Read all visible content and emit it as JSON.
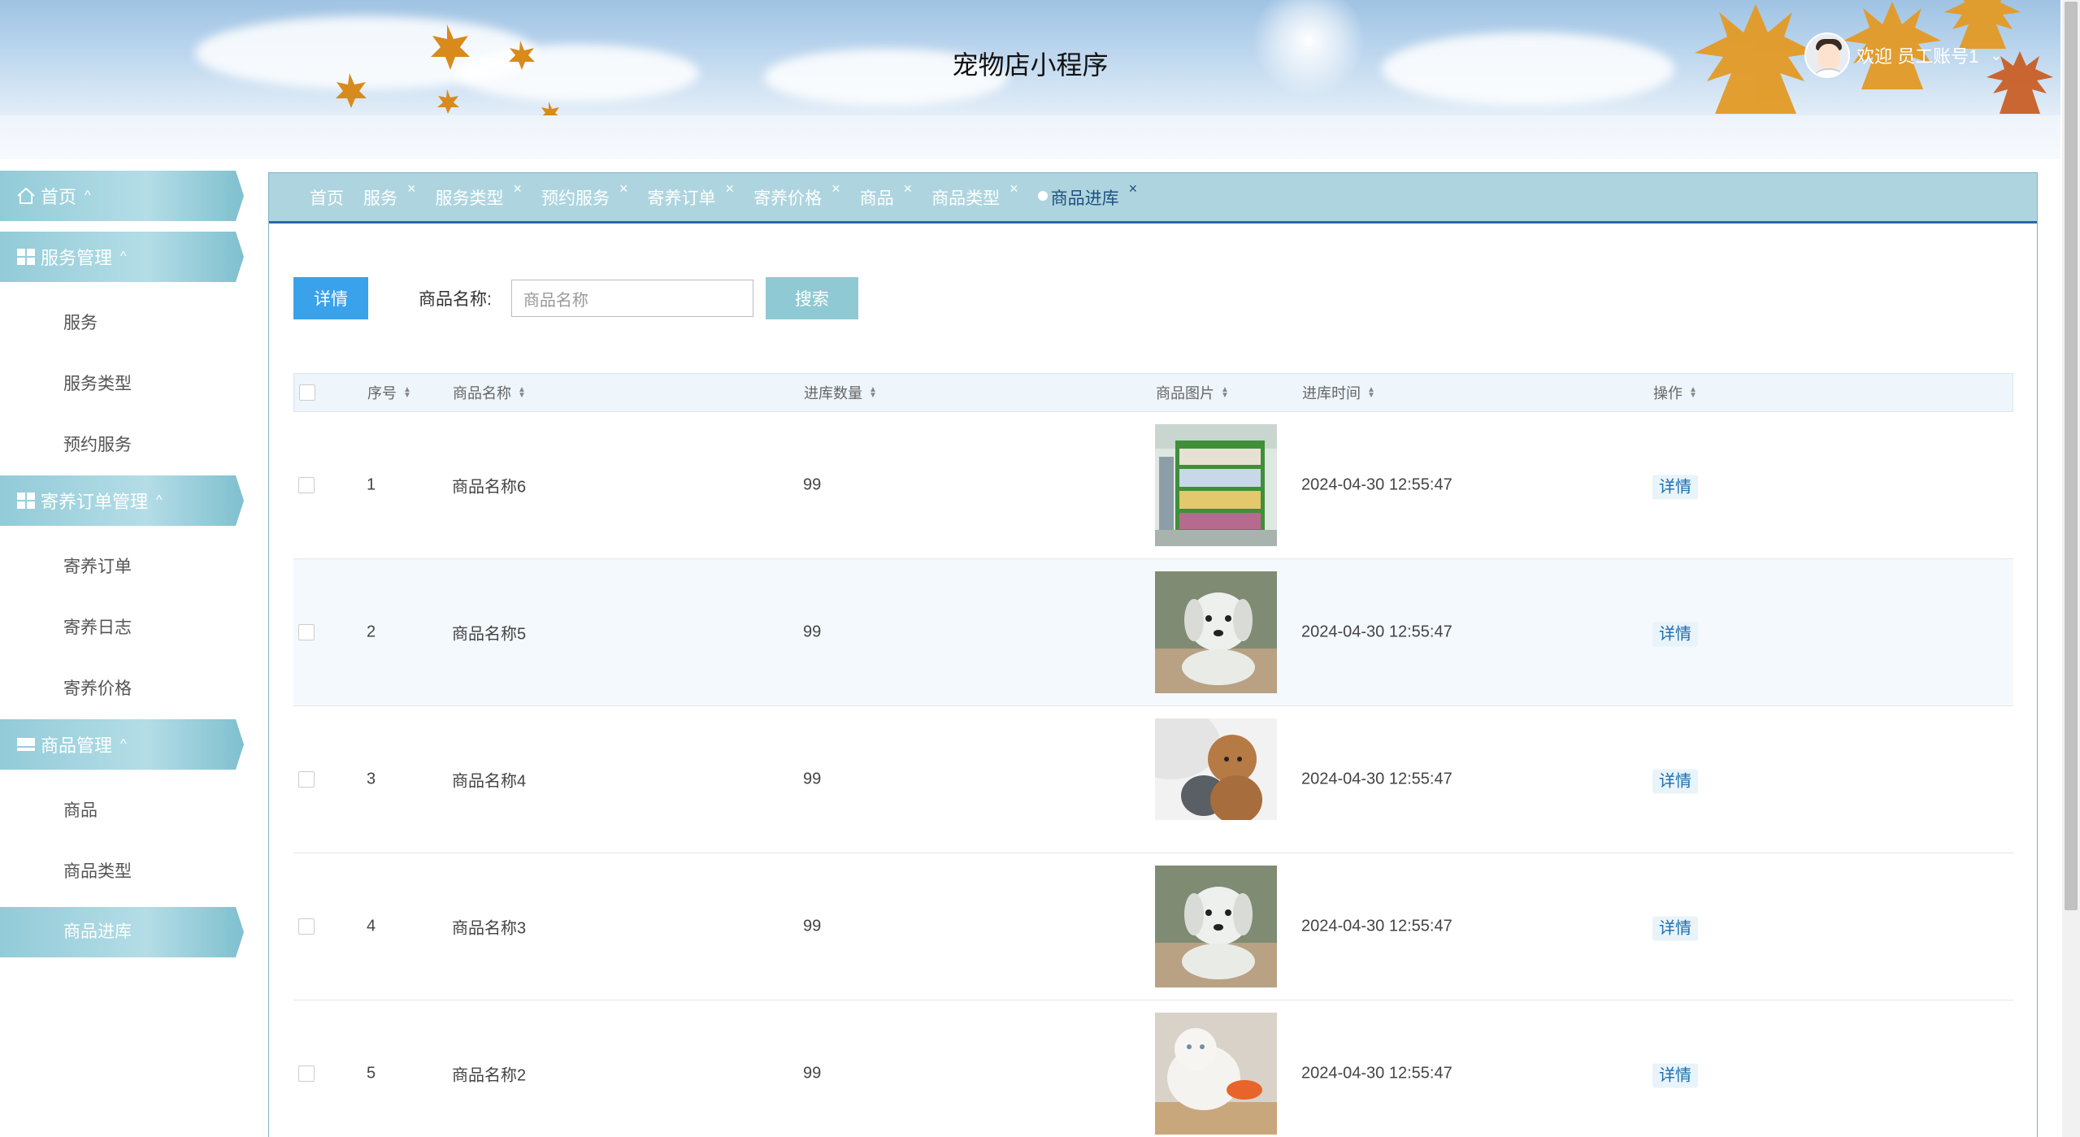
{
  "header": {
    "title": "宠物店小程序",
    "welcome": "欢迎 员工账号1"
  },
  "sidebar": {
    "groups": [
      {
        "label": "首页",
        "icon": "home-icon",
        "items": []
      },
      {
        "label": "服务管理",
        "icon": "grid-icon",
        "items": [
          "服务",
          "服务类型",
          "预约服务"
        ]
      },
      {
        "label": "寄养订单管理",
        "icon": "grid-icon",
        "items": [
          "寄养订单",
          "寄养日志",
          "寄养价格"
        ]
      },
      {
        "label": "商品管理",
        "icon": "list-icon",
        "items": [
          "商品",
          "商品类型",
          "商品进库"
        ]
      }
    ],
    "active_item": "商品进库"
  },
  "tabs": [
    "首页",
    "服务",
    "服务类型",
    "预约服务",
    "寄养订单",
    "寄养价格",
    "商品",
    "商品类型",
    "商品进库"
  ],
  "active_tab": "商品进库",
  "toolbar": {
    "detail_label": "详情",
    "search_label": "商品名称:",
    "search_placeholder": "商品名称",
    "search_button": "搜索"
  },
  "table": {
    "columns": [
      "序号",
      "商品名称",
      "进库数量",
      "商品图片",
      "进库时间",
      "操作"
    ],
    "rows": [
      {
        "index": "1",
        "name": "商品名称6",
        "qty": "99",
        "image": "pet-shop-shelves",
        "time": "2024-04-30 12:55:47",
        "action": "详情"
      },
      {
        "index": "2",
        "name": "商品名称5",
        "qty": "99",
        "image": "white-puppy",
        "time": "2024-04-30 12:55:47",
        "action": "详情"
      },
      {
        "index": "3",
        "name": "商品名称4",
        "qty": "99",
        "image": "poodle-and-cat",
        "time": "2024-04-30 12:55:47",
        "action": "详情"
      },
      {
        "index": "4",
        "name": "商品名称3",
        "qty": "99",
        "image": "white-puppy",
        "time": "2024-04-30 12:55:47",
        "action": "详情"
      },
      {
        "index": "5",
        "name": "商品名称2",
        "qty": "99",
        "image": "white-kitten",
        "time": "2024-04-30 12:55:47",
        "action": "详情"
      }
    ]
  },
  "colors": {
    "accent": "#3aa2ea",
    "menu": "#92cbd8",
    "tab_bar": "#aed5df",
    "link": "#1a6eb0"
  }
}
